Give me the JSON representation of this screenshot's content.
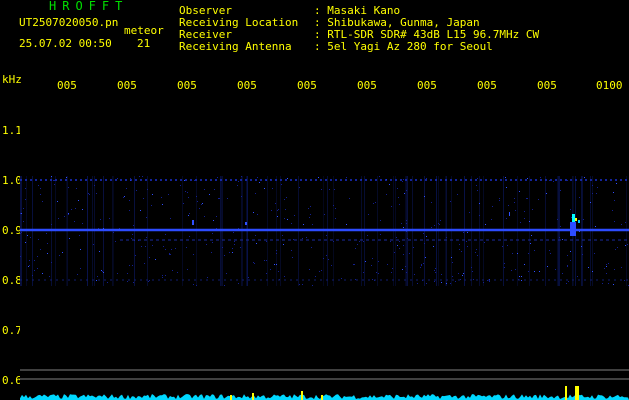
{
  "header": {
    "app_name": "HROFFT",
    "file_name": "UT2507020050.pn",
    "meteor_label": "meteor",
    "datetime": "25.07.02 00:50",
    "meteor_count": "21"
  },
  "info": [
    {
      "key": "Observer",
      "value": ": Masaki Kano"
    },
    {
      "key": "Receiving Location",
      "value": ": Shibukawa, Gunma, Japan"
    },
    {
      "key": "Receiver",
      "value": ": RTL-SDR SDR# 43dB L15 96.7MHz CW"
    },
    {
      "key": "Receiving Antenna",
      "value": ": 5el Yagi Az 280 for Seoul"
    }
  ],
  "axis": {
    "y_unit": "kHz",
    "y_ticks": [
      "1.1",
      "1.0",
      "0.9",
      "0.8",
      "0.7",
      "0.6"
    ],
    "x_ticks": [
      "005",
      "005",
      "005",
      "005",
      "005",
      "005",
      "005",
      "005",
      "005",
      "0100"
    ]
  },
  "colors": {
    "text": "#ffff00",
    "title": "#00e000",
    "signal": "#2040ff",
    "baseline": "#00d8ff"
  }
}
